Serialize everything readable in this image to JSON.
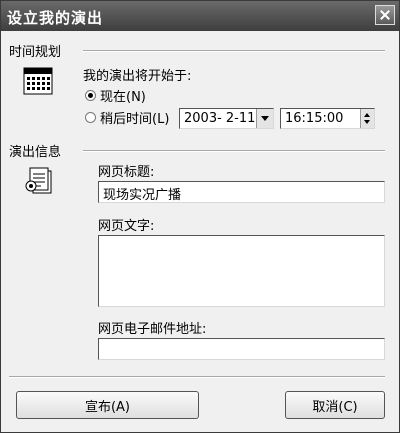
{
  "window": {
    "title": "设立我的演出"
  },
  "schedule": {
    "section_label": "时间规划",
    "prompt": "我的演出将开始于:",
    "now_option": "现在(N)",
    "later_option": "稍后时间(L)",
    "selected": "now",
    "date_value": "2003- 2-11",
    "time_value": "16:15:00",
    "calendar_icon": "calendar-icon"
  },
  "info": {
    "section_label": "演出信息",
    "page_title_label": "网页标题:",
    "page_title_value": "现场实况广播",
    "page_text_label": "网页文字:",
    "page_text_value": "",
    "email_label": "网页电子邮件地址:",
    "email_value": "",
    "info_icon": "document-info-icon"
  },
  "buttons": {
    "publish": "宣布(A)",
    "cancel": "取消(C)"
  }
}
